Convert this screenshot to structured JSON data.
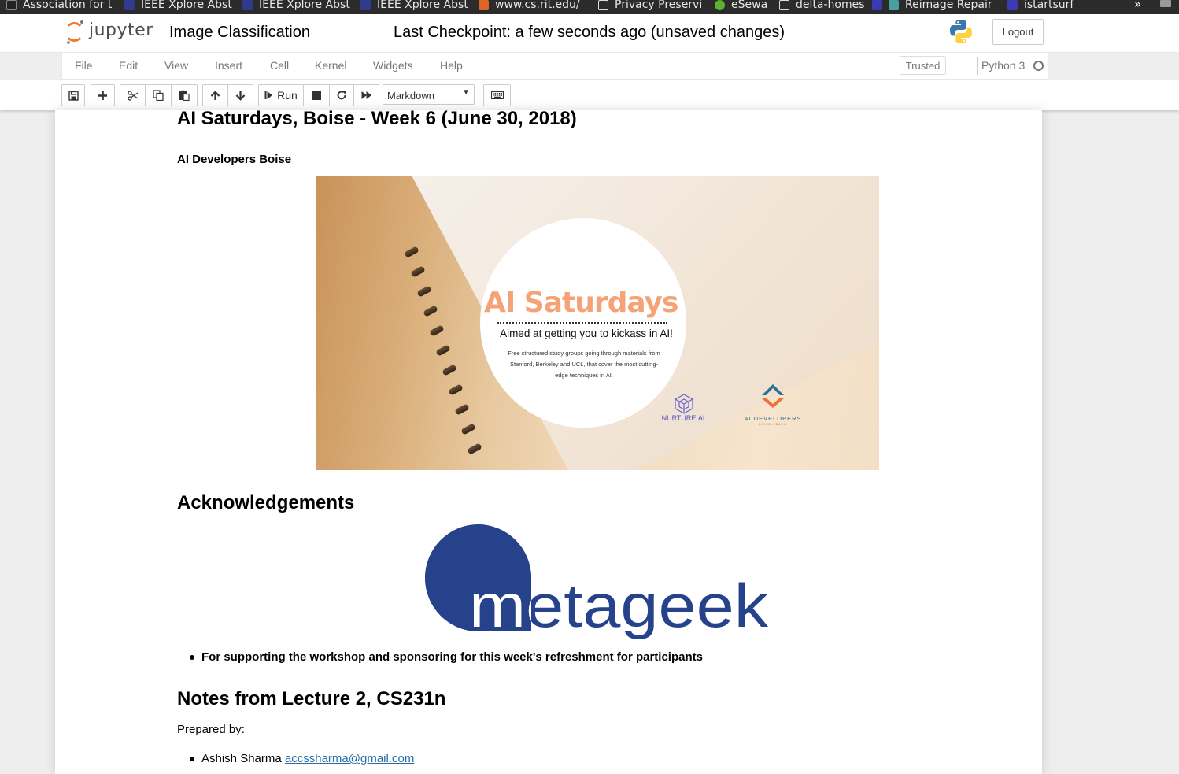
{
  "bookmarks": [
    {
      "label": "Association for t",
      "color": "#222222"
    },
    {
      "label": "IEEE Xplore Abst",
      "color": "#2f3c8c"
    },
    {
      "label": "IEEE Xplore Abst",
      "color": "#2f3c8c"
    },
    {
      "label": "IEEE Xplore Abst",
      "color": "#2f3c8c"
    },
    {
      "label": "www.cs.rit.edu/",
      "color": "#e0632a"
    },
    {
      "label": "Privacy Preservi",
      "color": "#dddddd"
    },
    {
      "label": "eSewa",
      "color": "#5cb130"
    },
    {
      "label": "delta-homes",
      "color": "#dddddd"
    },
    {
      "label": "Reimage Repair",
      "color": "#4aa0a0"
    },
    {
      "label": "istartsurf",
      "color": "#3b3bb5"
    }
  ],
  "bookmarks_more": "»",
  "header": {
    "logo_text": "jupyter",
    "notebook_title": "Image Classification",
    "checkpoint": "Last Checkpoint: a few seconds ago  (unsaved changes)",
    "logout_label": "Logout"
  },
  "menu": {
    "items": [
      "File",
      "Edit",
      "View",
      "Insert",
      "Cell",
      "Kernel",
      "Widgets",
      "Help"
    ],
    "trusted_label": "Trusted",
    "kernel_name": "Python 3"
  },
  "toolbar": {
    "run_label": "Run",
    "cell_type": "Markdown",
    "icons": [
      "save-icon",
      "plus-icon",
      "cut-icon",
      "copy-icon",
      "paste-icon",
      "arrow-up-icon",
      "arrow-down-icon",
      "step-forward-icon",
      "stop-icon",
      "restart-icon",
      "fast-forward-icon",
      "keyboard-icon"
    ]
  },
  "notebook": {
    "heading": "AI Saturdays, Boise - Week 6 (June 30, 2018)",
    "subheading": "AI Developers Boise",
    "banner": {
      "title": "AI Saturdays",
      "subtitle": "Aimed at getting you to kickass in AI!",
      "description": "Free structured study groups going through materials from Stanford, Berkeley and UCL, that cover the most cutting-edge techniques in AI.",
      "nurture_label": "NURTURE.AI",
      "aidev_label": "AI DEVELOPERS",
      "aidev_sub": "BOISE, IDAHO"
    },
    "ack_heading": "Acknowledgements",
    "metageek_text": "metageek",
    "ack_bullet": "For supporting the workshop and sponsoring for this week's refreshment for participants",
    "notes_heading": "Notes from Lecture 2, CS231n",
    "prepared_by": "Prepared by:",
    "author_name": "Ashish Sharma ",
    "author_email": "accssharma@gmail.com"
  },
  "colors": {
    "jupyter_orange": "#f37726",
    "banner_title": "#f4a276",
    "metageek_blue": "#26428b",
    "link": "#296eaa"
  }
}
